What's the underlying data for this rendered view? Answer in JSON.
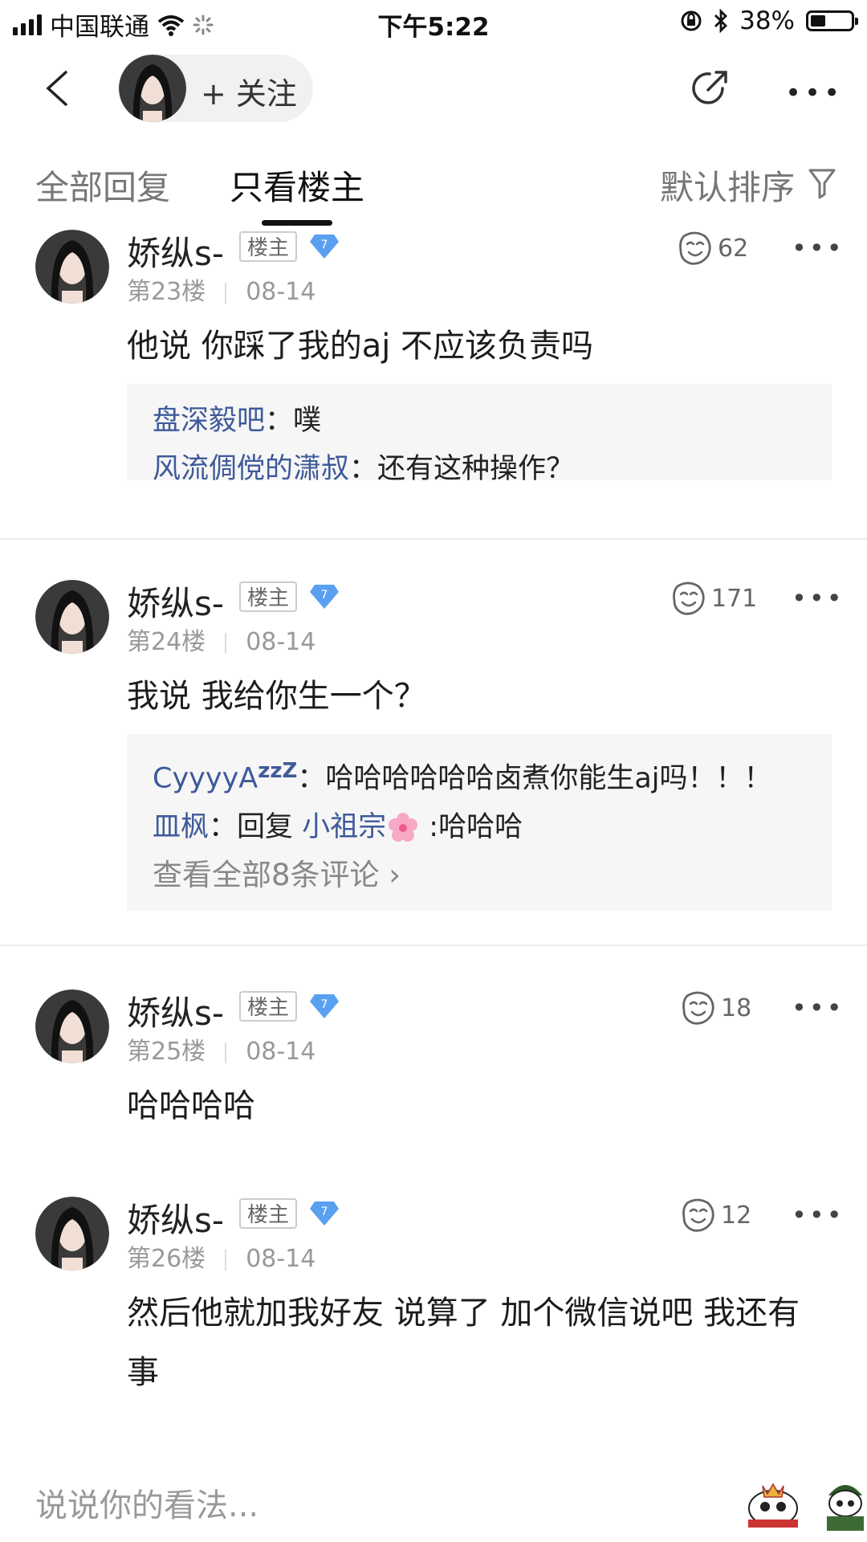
{
  "status_bar": {
    "carrier": "中国联通",
    "time": "下午5:22",
    "battery": "38%",
    "battery_level": 0.38
  },
  "nav": {
    "follow_label": "+ 关注"
  },
  "tabs": {
    "all": "全部回复",
    "owner_only": "只看楼主",
    "sort": "默认排序"
  },
  "posts": [
    {
      "user": "娇纵s-",
      "tag": "楼主",
      "level": "7",
      "floor": "第23楼",
      "date": "08-14",
      "likes": "62",
      "content": "他说 你踩了我的aj 不应该负责吗",
      "replies": [
        {
          "name": "盘深毅吧",
          "text": "：噗"
        },
        {
          "name": "风流倜傥的潇叔",
          "text": "：还有这种操作？"
        }
      ]
    },
    {
      "user": "娇纵s-",
      "tag": "楼主",
      "level": "7",
      "floor": "第24楼",
      "date": "08-14",
      "likes": "171",
      "content": "我说 我给你生一个？",
      "replies": [
        {
          "name": "CyyyyA",
          "sup": "zzZ",
          "text": "：哈哈哈哈哈哈卤煮你能生aj吗！！！"
        },
        {
          "name": "皿枫",
          "text": "：回复 ",
          "mention": "小祖宗",
          "tail": " :哈哈哈"
        }
      ],
      "view_all": "查看全部8条评论 ›"
    },
    {
      "user": "娇纵s-",
      "tag": "楼主",
      "level": "7",
      "floor": "第25楼",
      "date": "08-14",
      "likes": "18",
      "content": "哈哈哈哈"
    },
    {
      "user": "娇纵s-",
      "tag": "楼主",
      "level": "7",
      "floor": "第26楼",
      "date": "08-14",
      "likes": "12",
      "content": "然后他就加我好友 说算了 加个微信说吧 我还有事"
    }
  ],
  "bottom": {
    "placeholder": "说说你的看法..."
  },
  "icons": {
    "back": "chevron-left-icon",
    "share": "share-icon",
    "more": "more-dots-icon",
    "filter": "filter-icon",
    "like": "like-face-icon",
    "level_badge": "diamond-badge-icon",
    "flower": "cherry-blossom-emoji"
  },
  "colors": {
    "link_name": "#3e5a9a",
    "level_badge": "#5aa0f0"
  }
}
